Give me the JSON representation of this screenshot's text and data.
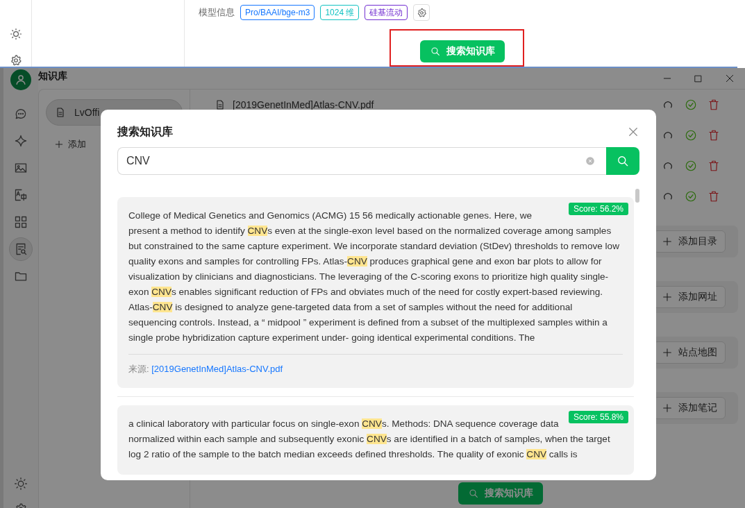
{
  "top_panel": {
    "model_label": "模型信息",
    "tags": [
      {
        "text": "Pro/BAAI/bge-m3",
        "color": "#1677ff"
      },
      {
        "text": "1024 维",
        "color": "#13c2c2"
      },
      {
        "text": "硅基流动",
        "color": "#722ed1"
      }
    ],
    "search_button": "搜索知识库"
  },
  "window": {
    "title": "知识库"
  },
  "rail": [
    {
      "kind": "chat",
      "selected": false
    },
    {
      "kind": "sparkle",
      "selected": false
    },
    {
      "kind": "image",
      "selected": false
    },
    {
      "kind": "translate",
      "selected": false
    },
    {
      "kind": "apps",
      "selected": false
    },
    {
      "kind": "knowledge",
      "selected": true
    },
    {
      "kind": "folder",
      "selected": false
    }
  ],
  "knowledge_bases": [
    {
      "label": "LvOffi",
      "selected": true
    }
  ],
  "add_label": "添加",
  "files": [
    {
      "name": "[2019GenetInMed]Atlas-CNV.pdf",
      "done": true
    },
    {
      "done": true
    },
    {
      "done": true
    },
    {
      "done": true
    }
  ],
  "add_buttons": [
    "添加目录",
    "添加网址",
    "站点地图",
    "添加笔记"
  ],
  "search_button": "搜索知识库",
  "dialog": {
    "title": "搜索知识库",
    "query": "CNV",
    "results": [
      {
        "score": "Score: 56.2%",
        "segments": [
          {
            "text": "College of Medical Genetics and Genomics (ACMG) 15 56 medically actionable genes. Here, we present",
            "highlight": false
          },
          {
            "text": " a method to identify ",
            "highlight": false
          },
          {
            "text": "CNV",
            "highlight": true
          },
          {
            "text": "s even at the single-exon level based on the normalized coverage among samples but constrained to the same capture experiment. We incorporate standard deviation (StDev) thresholds to remove low quality exons and samples for controlling FPs. Atlas-",
            "highlight": false
          },
          {
            "text": "CNV",
            "highlight": true
          },
          {
            "text": " produces graphical gene and exon bar plots to allow for visualization by clinicians and diagnosticians. The leveraging of the C-scoring exons to prioritize high quality single-exon ",
            "highlight": false
          },
          {
            "text": "CNV",
            "highlight": true
          },
          {
            "text": "s enables significant reduction of FPs and obviates much of the need for costly expert-based reviewing. Atlas-",
            "highlight": false
          },
          {
            "text": "CNV",
            "highlight": true
          },
          {
            "text": " is designed to analyze gene-targeted data from a set of samples without the need for additional sequencing controls. Instead, a “ midpool ” experiment is defined from a subset of the multiplexed samples within a single probe hybridization capture experiment under- going identical experimental conditions. The",
            "highlight": false
          }
        ],
        "source_label": "来源:",
        "source": "[2019GenetInMed]Atlas-CNV.pdf"
      },
      {
        "score": "Score: 55.8%",
        "segments": [
          {
            "text": "a clinical laboratory with particular focus on single-exon ",
            "highlight": false
          },
          {
            "text": "CNV",
            "highlight": true
          },
          {
            "text": "s. Methods: DNA sequence coverage data",
            "highlight": false
          },
          {
            "text": " normalized within each sample and subsequently exonic ",
            "highlight": false
          },
          {
            "text": "CNV",
            "highlight": true
          },
          {
            "text": "s are identified in a batch of samples, when the target log 2 ratio of the sample to the batch median exceeds defined thresholds. The quality of exonic ",
            "highlight": false
          },
          {
            "text": "CNV",
            "highlight": true
          },
          {
            "text": " calls is",
            "highlight": false
          }
        ]
      }
    ]
  }
}
